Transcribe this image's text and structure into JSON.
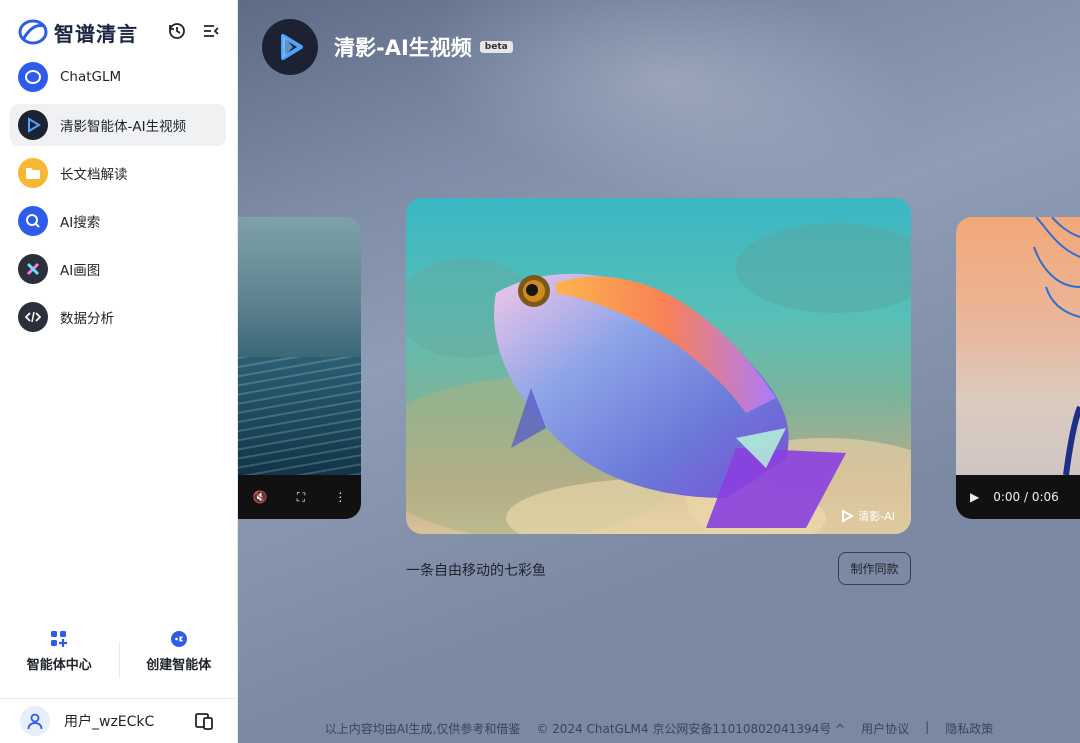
{
  "brand": {
    "name": "智谱清言"
  },
  "sidebar": {
    "items": [
      {
        "label": "ChatGLM"
      },
      {
        "label": "清影智能体-AI生视频"
      },
      {
        "label": "长文档解读"
      },
      {
        "label": "AI搜索"
      },
      {
        "label": "AI画图"
      },
      {
        "label": "数据分析"
      }
    ],
    "agent_center": "智能体中心",
    "create_agent": "创建智能体",
    "username": "用户_wzECkC"
  },
  "header": {
    "title": "清影-AI生视频",
    "badge": "beta"
  },
  "video": {
    "caption": "一条自由移动的七彩鱼",
    "make_same": "制作同款",
    "watermark": "清影-AI",
    "right_time": "0:00 / 0:06"
  },
  "footer": {
    "disclaimer": "以上内容均由AI生成,仅供参考和借鉴",
    "copyright": "© 2024 ChatGLM4 京公网安备11010802041394号 ^",
    "agreement": "用户协议",
    "sep": "|",
    "privacy": "隐私政策"
  },
  "colors": {
    "accent": "#2f5bea",
    "main_bg": "#7d8ba6"
  }
}
